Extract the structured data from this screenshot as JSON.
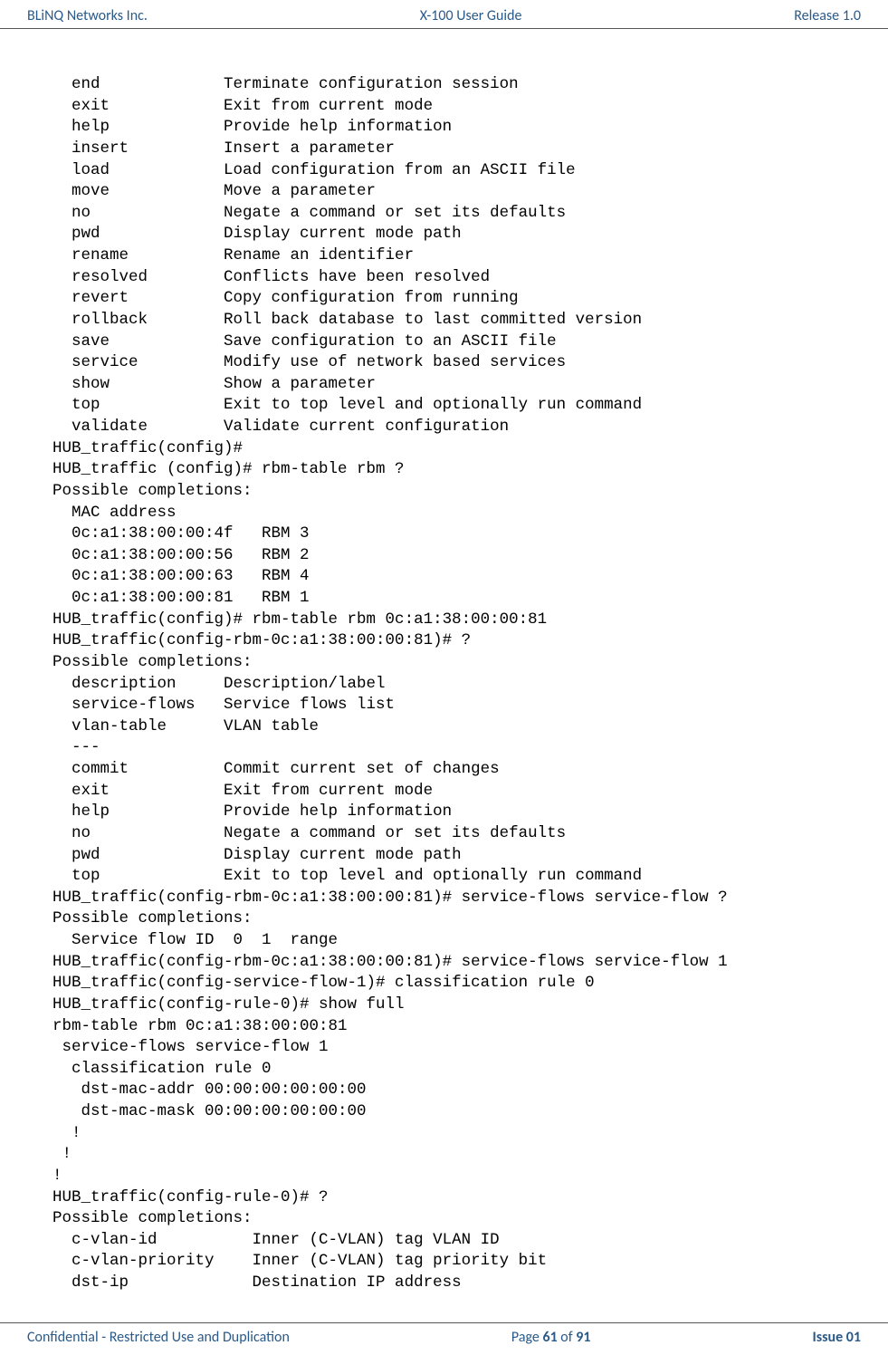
{
  "header": {
    "left": "BLiNQ Networks Inc.",
    "center": "X-100 User Guide",
    "right": "Release 1.0"
  },
  "footer": {
    "left": "Confidential - Restricted Use and Duplication",
    "page_prefix": "Page ",
    "page_current": "61",
    "page_mid": " of ",
    "page_total": "91",
    "issue": "Issue 01"
  },
  "terminal": "  end             Terminate configuration session\n  exit            Exit from current mode\n  help            Provide help information\n  insert          Insert a parameter\n  load            Load configuration from an ASCII file\n  move            Move a parameter\n  no              Negate a command or set its defaults\n  pwd             Display current mode path\n  rename          Rename an identifier\n  resolved        Conflicts have been resolved\n  revert          Copy configuration from running\n  rollback        Roll back database to last committed version\n  save            Save configuration to an ASCII file\n  service         Modify use of network based services\n  show            Show a parameter\n  top             Exit to top level and optionally run command\n  validate        Validate current configuration\nHUB_traffic(config)#\nHUB_traffic (config)# rbm-table rbm ?\nPossible completions:\n  MAC address\n  0c:a1:38:00:00:4f   RBM 3\n  0c:a1:38:00:00:56   RBM 2\n  0c:a1:38:00:00:63   RBM 4\n  0c:a1:38:00:00:81   RBM 1\nHUB_traffic(config)# rbm-table rbm 0c:a1:38:00:00:81\nHUB_traffic(config-rbm-0c:a1:38:00:00:81)# ?\nPossible completions:\n  description     Description/label\n  service-flows   Service flows list\n  vlan-table      VLAN table\n  ---\n  commit          Commit current set of changes\n  exit            Exit from current mode\n  help            Provide help information\n  no              Negate a command or set its defaults\n  pwd             Display current mode path\n  top             Exit to top level and optionally run command\nHUB_traffic(config-rbm-0c:a1:38:00:00:81)# service-flows service-flow ?\nPossible completions:\n  Service flow ID  0  1  range\nHUB_traffic(config-rbm-0c:a1:38:00:00:81)# service-flows service-flow 1\nHUB_traffic(config-service-flow-1)# classification rule 0\nHUB_traffic(config-rule-0)# show full\nrbm-table rbm 0c:a1:38:00:00:81\n service-flows service-flow 1\n  classification rule 0\n   dst-mac-addr 00:00:00:00:00:00\n   dst-mac-mask 00:00:00:00:00:00\n  !\n !\n!\nHUB_traffic(config-rule-0)# ?\nPossible completions:\n  c-vlan-id          Inner (C-VLAN) tag VLAN ID\n  c-vlan-priority    Inner (C-VLAN) tag priority bit\n  dst-ip             Destination IP address"
}
